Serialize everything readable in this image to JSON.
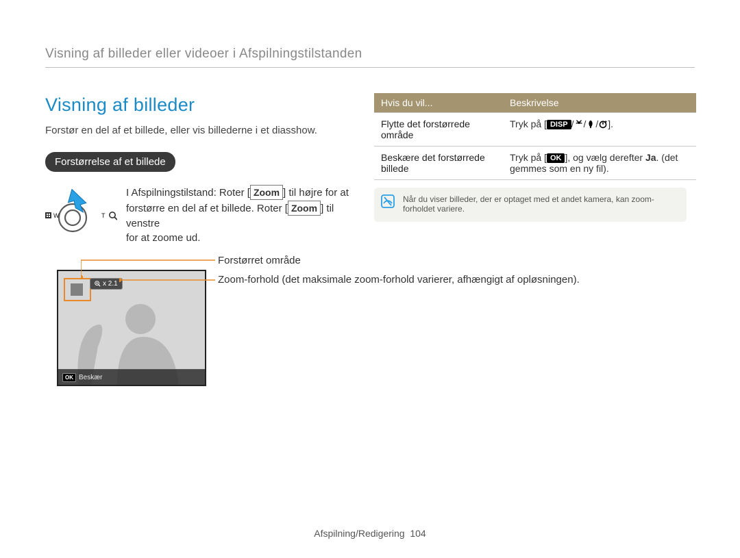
{
  "header": {
    "title": "Visning af billeder eller videoer i Afspilningstilstanden"
  },
  "section": {
    "title": "Visning af billeder",
    "desc": "Forstør en del af et billede, eller vis billederne i et diasshow."
  },
  "pill": {
    "label": "Forstørrelse af et billede"
  },
  "zoom_instructions": {
    "pre1": "I Afspilningstilstand: Roter [",
    "zoom": "Zoom",
    "post1": "] til højre for at",
    "line2a": "forstørre en del af et billede. Roter [",
    "line2b": "] til venstre",
    "line3": "for at zoome ud."
  },
  "dial": {
    "w_label": "W",
    "t_label": "T"
  },
  "preview": {
    "zoom_ratio": "x 2.1",
    "crop_label": "Beskær",
    "ok_label": "OK"
  },
  "callouts": {
    "enlarged_area": "Forstørret område",
    "zoom_ratio": "Zoom-forhold (det maksimale zoom-forhold varierer, afhængigt af opløsningen)."
  },
  "table": {
    "head_left": "Hvis du vil...",
    "head_right": "Beskrivelse",
    "rows": [
      {
        "k": "Flytte det forstørrede område",
        "v_pre": "Tryk på [",
        "v_disp": "DISP",
        "v_sep": "/",
        "v_post": "]."
      },
      {
        "k": "Beskære det forstørrede billede",
        "v_pre": "Tryk på [",
        "v_ok": "OK",
        "v_mid": "], og vælg derefter ",
        "v_ja": "Ja",
        "v_post2": ". (det gemmes som en ny fil)."
      }
    ]
  },
  "note": {
    "text": "Når du viser billeder, der er optaget med et andet kamera, kan zoom-forholdet variere."
  },
  "footer": {
    "section": "Afspilning/Redigering",
    "page": "104"
  }
}
